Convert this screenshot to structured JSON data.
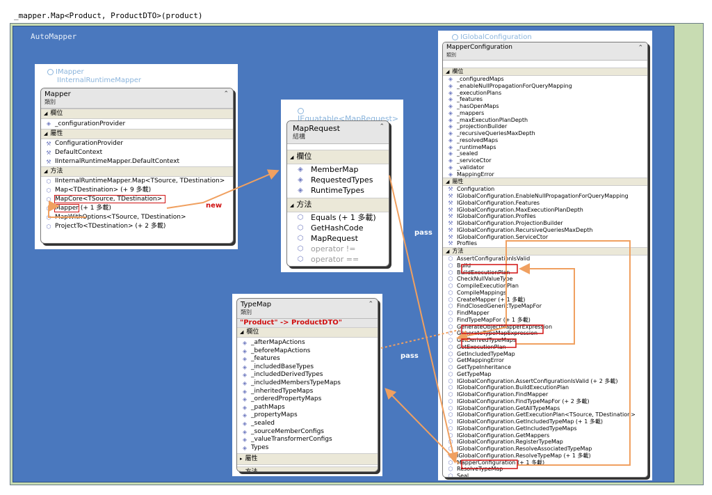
{
  "caption": "_mapper.Map<Product, ProductDTO>(product)",
  "area_title": "AutoMapper",
  "mapper": {
    "iface1": "IMapper",
    "iface2": "IInternalRuntimeMapper",
    "name": "Mapper",
    "kind": "類別",
    "sections": {
      "fields": "欄位",
      "props": "屬性",
      "methods": "方法"
    },
    "fields": [
      "_configurationProvider"
    ],
    "props": [
      "ConfigurationProvider",
      "DefaultContext",
      "IInternalRuntimeMapper.DefaultContext"
    ],
    "methods": [
      "IInternalRuntimeMapper.Map<TSource, TDestination>",
      "Map<TDestination> (+ 9 多載)",
      "MapCore<TSource, TDestination>",
      "Mapper",
      "MapWithOptions<TSource, TDestination>",
      "ProjectTo<TDestination> (+ 2 多載)"
    ],
    "ctor_overload": "(+ 1 多載)"
  },
  "maprequest": {
    "iface": "IEquatable<MapRequest>",
    "name": "MapRequest",
    "kind": "結構",
    "sections": {
      "fields": "欄位",
      "methods": "方法"
    },
    "fields": [
      "MemberMap",
      "RequestedTypes",
      "RuntimeTypes"
    ],
    "methods": [
      "Equals (+ 1 多載)",
      "GetHashCode",
      "MapRequest",
      "operator !=",
      "operator =="
    ]
  },
  "typemap": {
    "name": "TypeMap",
    "kind": "類別",
    "annotation": "\"Product\" -> ProductDTO\"",
    "sections": {
      "fields": "欄位",
      "props": "屬性",
      "methods": "方法"
    },
    "fields": [
      "_afterMapActions",
      "_beforeMapActions",
      "_features",
      "_includedBaseTypes",
      "_includedDerivedTypes",
      "_includedMembersTypeMaps",
      "_inheritedTypeMaps",
      "_orderedPropertyMaps",
      "_pathMaps",
      "_propertyMaps",
      "_sealed",
      "_sourceMemberConfigs",
      "_valueTransformerConfigs",
      "Types"
    ]
  },
  "mapperconfig": {
    "iface": "IGlobalConfiguration",
    "name": "MapperConfiguration",
    "kind": "類別",
    "sections": {
      "fields": "欄位",
      "props": "屬性",
      "methods": "方法"
    },
    "fields": [
      "_configuredMaps",
      "_enableNullPropagationForQueryMapping",
      "_executionPlans",
      "_features",
      "_hasOpenMaps",
      "_mappers",
      "_maxExecutionPlanDepth",
      "_projectionBuilder",
      "_recursiveQueriesMaxDepth",
      "_resolvedMaps",
      "_runtimeMaps",
      "_sealed",
      "_serviceCtor",
      "_validator",
      "MappingError"
    ],
    "props": [
      "Configuration",
      "IGlobalConfiguration.EnableNullPropagationForQueryMapping",
      "IGlobalConfiguration.Features",
      "IGlobalConfiguration.MaxExecutionPlanDepth",
      "IGlobalConfiguration.Profiles",
      "IGlobalConfiguration.ProjectionBuilder",
      "IGlobalConfiguration.RecursiveQueriesMaxDepth",
      "IGlobalConfiguration.ServiceCtor",
      "Profiles"
    ],
    "methods": [
      "AssertConfigurationIsValid",
      "Build",
      "BuildExecutionPlan",
      "CheckNullValueType",
      "CompileExecutionPlan",
      "CompileMappings",
      "CreateMapper (+ 1 多載)",
      "FindClosedGenericTypeMapFor",
      "FindMapper",
      "FindTypeMapFor (+ 1 多載)",
      "GenerateObjectMapperExpression",
      "GenerateTypeMapExpression",
      "GetDerivedTypeMaps",
      "GetExecutionPlan",
      "GetIncludedTypeMap",
      "GetMappingError",
      "GetTypeInheritance",
      "GetTypeMap",
      "IGlobalConfiguration.AssertConfigurationIsValid (+ 2 多載)",
      "IGlobalConfiguration.BuildExecutionPlan",
      "IGlobalConfiguration.FindMapper",
      "IGlobalConfiguration.FindTypeMapFor (+ 2 多載)",
      "IGlobalConfiguration.GetAllTypeMaps",
      "IGlobalConfiguration.GetExecutionPlan<TSource, TDestination>",
      "IGlobalConfiguration.GetIncludedTypeMap (+ 1 多載)",
      "IGlobalConfiguration.GetIncludedTypeMaps",
      "IGlobalConfiguration.GetMappers",
      "IGlobalConfiguration.RegisterTypeMap",
      "IGlobalConfiguration.ResolveAssociatedTypeMap",
      "IGlobalConfiguration.ResolveTypeMap (+ 1 多載)",
      "MapperConfiguration (+ 1 多載)",
      "ResolveTypeMap",
      "Seal"
    ]
  },
  "labels": {
    "new": "new",
    "pass1": "pass",
    "pass2": "pass"
  },
  "colors": {
    "accent": "#f0a060",
    "highlight": "#d01010",
    "area": "#4a78be",
    "canvas": "#c8dcb2"
  }
}
